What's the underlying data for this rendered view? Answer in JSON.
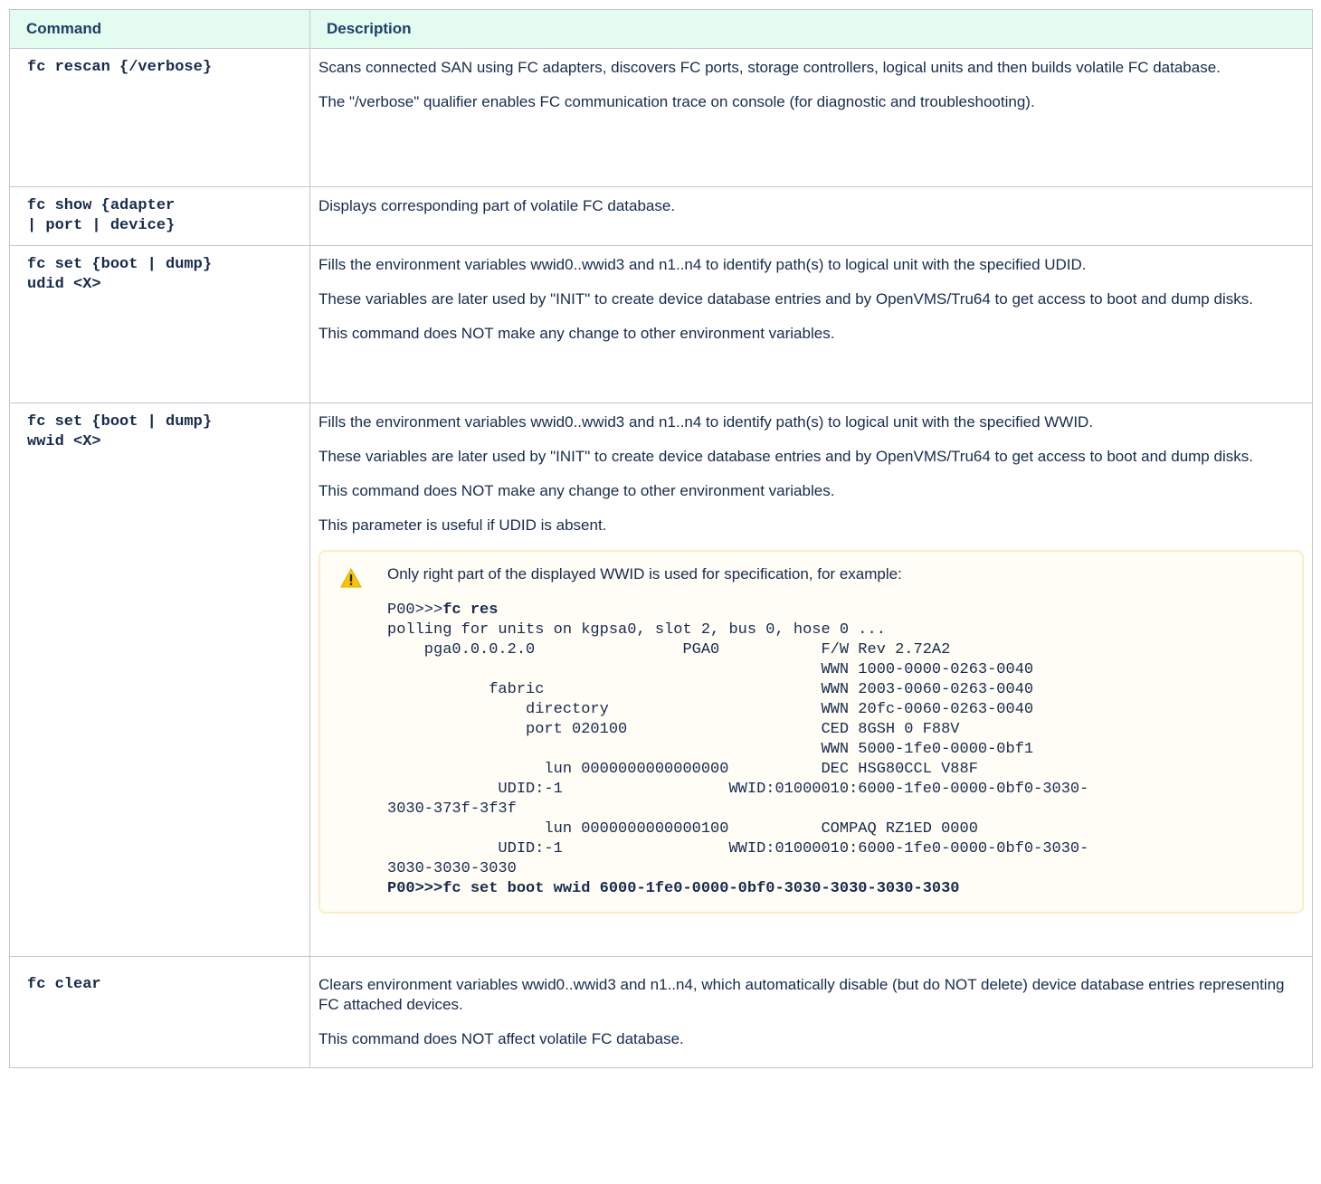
{
  "table": {
    "headers": {
      "command": "Command",
      "description": "Description"
    },
    "rows": [
      {
        "command": [
          "fc rescan {/verbose}"
        ],
        "description": [
          "Scans connected SAN using FC adapters, discovers FC ports, storage controllers, logical units and then builds volatile FC database.",
          "The \"/verbose\" qualifier enables FC communication trace on console (for diagnostic and troubleshooting)."
        ]
      },
      {
        "command": [
          "fc show {adapter",
          "| port | device}"
        ],
        "description": [
          "Displays corresponding part of volatile FC database."
        ]
      },
      {
        "command": [
          "fc set {boot | dump}",
          "udid <X>"
        ],
        "description": [
          "Fills the environment variables wwid0..wwid3 and n1..n4 to identify path(s) to logical unit with the specified UDID.",
          "These variables are later used by \"INIT\" to create device database entries and by OpenVMS/Tru64 to get access to boot and dump disks.",
          "This command does NOT make any change to other environment variables."
        ]
      },
      {
        "command": [
          "fc set {boot | dump}",
          "wwid <X>"
        ],
        "description": [
          "Fills the environment variables wwid0..wwid3 and n1..n4 to identify path(s) to logical unit with the specified WWID.",
          "These variables are later used by \"INIT\" to create device database entries and by OpenVMS/Tru64 to get access to boot and dump disks.",
          "This command does NOT make any change to other environment variables.",
          "This parameter is useful if UDID is absent."
        ],
        "note": {
          "icon": "warning-icon",
          "text": "Only right part of the displayed WWID is used for specification, for example:",
          "prompt": "P00>>>",
          "prompt_cmd": "fc res",
          "console_lines": [
            "polling for units on kgpsa0, slot 2, bus 0, hose 0 ...",
            "    pga0.0.0.2.0                PGA0           F/W Rev 2.72A2",
            "                                               WWN 1000-0000-0263-0040",
            "           fabric                              WWN 2003-0060-0263-0040",
            "               directory                       WWN 20fc-0060-0263-0040",
            "               port 020100                     CED 8GSH 0 F88V",
            "                                               WWN 5000-1fe0-0000-0bf1",
            "                 lun 0000000000000000          DEC HSG80CCL V88F",
            "            UDID:-1                  WWID:01000010:6000-1fe0-0000-0bf0-3030-",
            "3030-373f-3f3f",
            "                 lun 0000000000000100          COMPAQ RZ1ED 0000",
            "            UDID:-1                  WWID:01000010:6000-1fe0-0000-0bf0-3030-",
            "3030-3030-3030"
          ],
          "final_command": "P00>>>fc set boot wwid 6000-1fe0-0000-0bf0-3030-3030-3030-3030"
        }
      },
      {
        "command": [
          "fc clear"
        ],
        "description": [
          "Clears environment variables wwid0..wwid3 and n1..n4, which automatically disable (but do NOT delete) device database entries representing FC attached devices.",
          "This command does NOT affect volatile FC database."
        ]
      }
    ]
  }
}
